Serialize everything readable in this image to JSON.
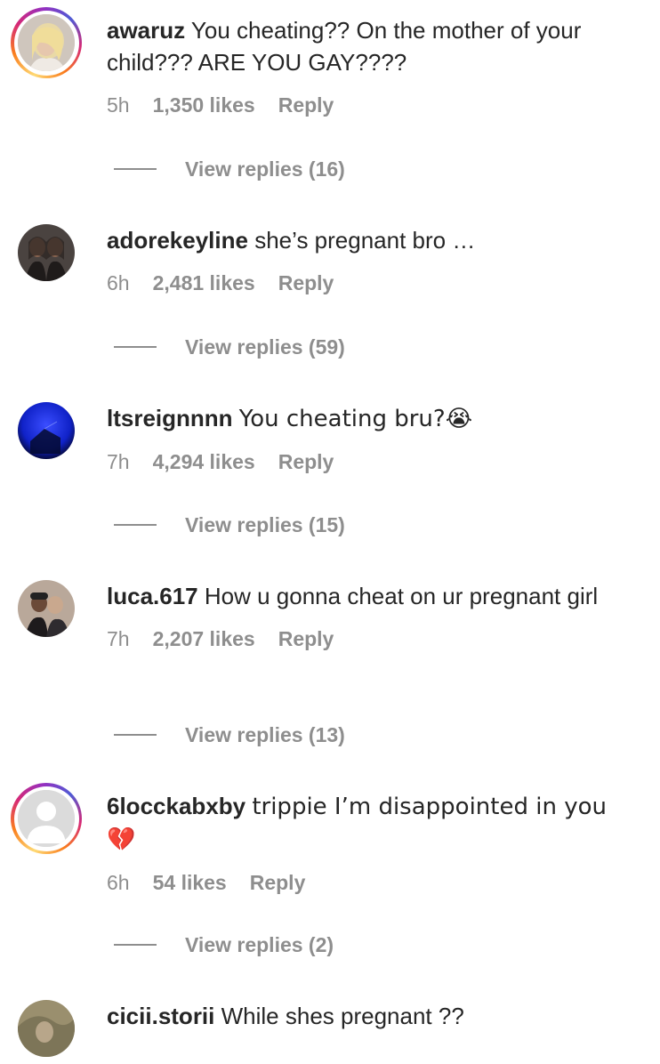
{
  "comments": [
    {
      "username": "awaruz",
      "text": "You cheating?? On the mother of your child??? ARE YOU GAY????",
      "time": "5h",
      "likes": "1,350 likes",
      "reply": "Reply",
      "view_replies": "View replies (16)",
      "has_story_ring": true
    },
    {
      "username": "adorekeyline",
      "text": "she’s pregnant bro …",
      "time": "6h",
      "likes": "2,481 likes",
      "reply": "Reply",
      "view_replies": "View replies (59)",
      "has_story_ring": false
    },
    {
      "username": "ltsreignnnn",
      "text": "You cheating bru?😭",
      "time": "7h",
      "likes": "4,294 likes",
      "reply": "Reply",
      "view_replies": "View replies (15)",
      "has_story_ring": false
    },
    {
      "username": "luca.617",
      "text": "How u gonna cheat on ur pregnant girl",
      "time": "7h",
      "likes": "2,207 likes",
      "reply": "Reply",
      "view_replies": "View replies (13)",
      "has_story_ring": false
    },
    {
      "username": "6locckabxby",
      "text": "trippie I’m disappointed in you 💔",
      "time": "6h",
      "likes": "54 likes",
      "reply": "Reply",
      "view_replies": "View replies (2)",
      "has_story_ring": true
    },
    {
      "username": "cicii.storii",
      "text": "While shes pregnant ??",
      "has_story_ring": false
    }
  ],
  "colors": {
    "text": "#262626",
    "muted": "#8e8e8e",
    "background": "#ffffff"
  }
}
